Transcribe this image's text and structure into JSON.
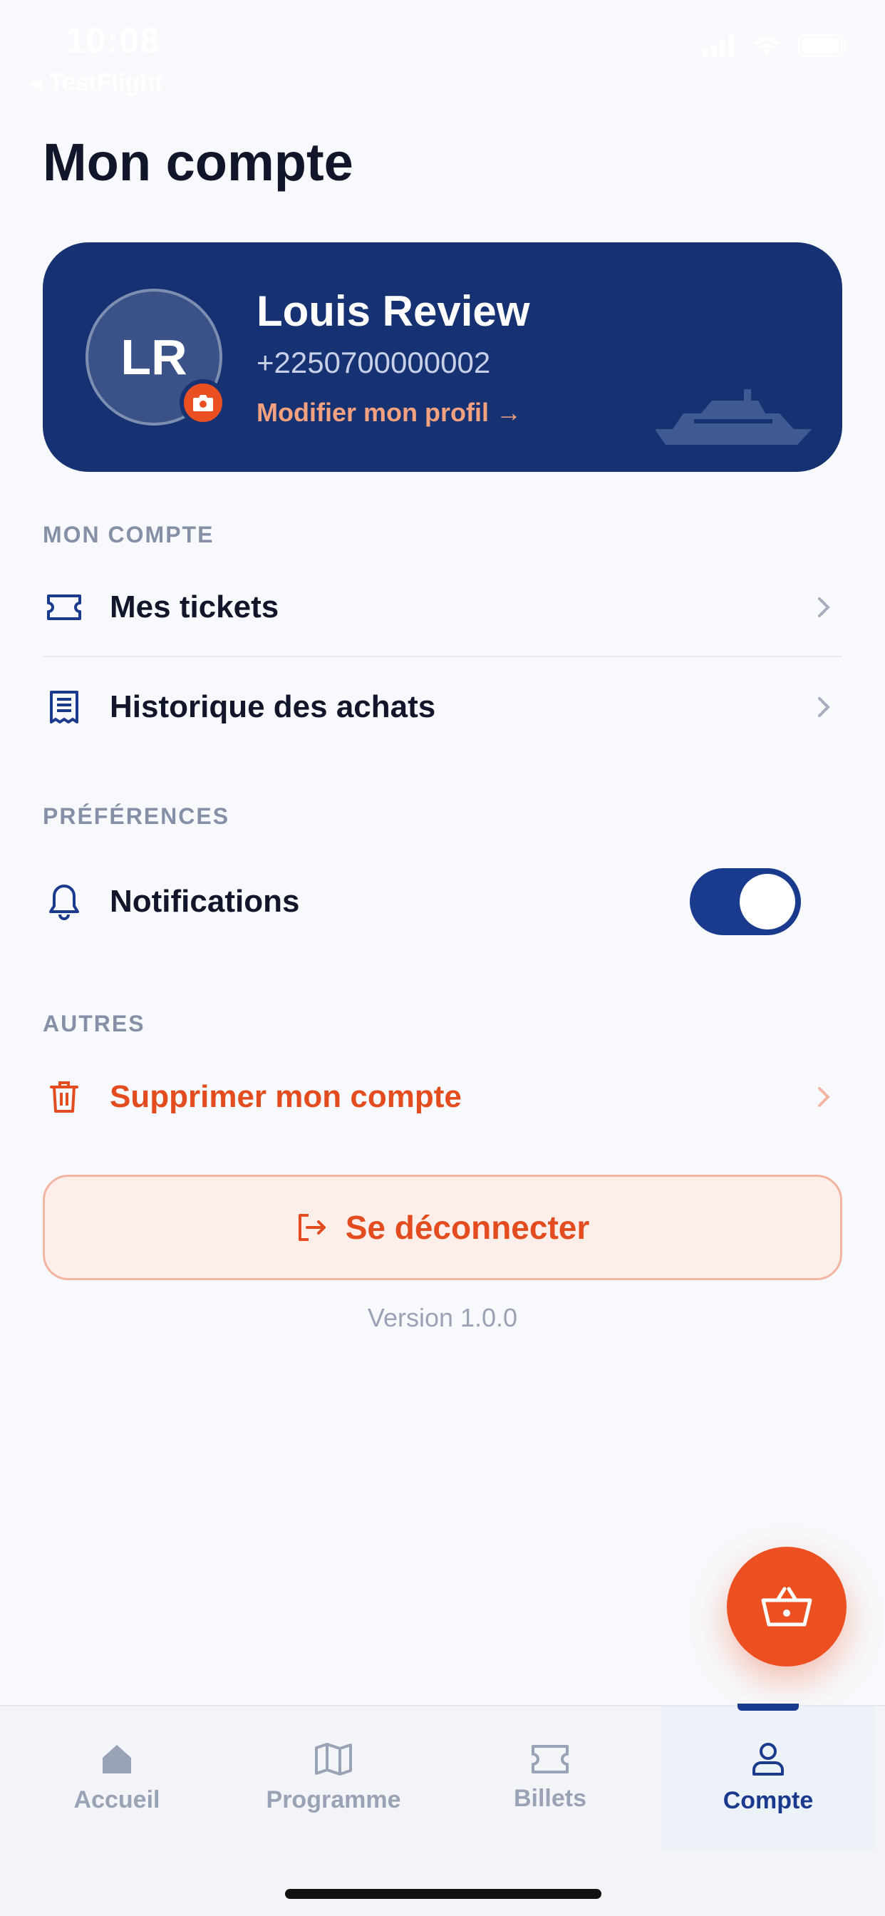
{
  "status_bar": {
    "time": "10:08",
    "back_label": "◂ TestFlight"
  },
  "page": {
    "title": "Mon compte"
  },
  "profile": {
    "initials": "LR",
    "name": "Louis Review",
    "phone": "+2250700000002",
    "edit_label": "Modifier mon profil →"
  },
  "sections": {
    "account": {
      "label": "MON COMPTE",
      "items": [
        {
          "label": "Mes tickets",
          "icon": "ticket-icon"
        },
        {
          "label": "Historique des achats",
          "icon": "receipt-icon"
        }
      ]
    },
    "preferences": {
      "label": "PRÉFÉRENCES",
      "notifications_label": "Notifications",
      "notifications_enabled": true
    },
    "others": {
      "label": "AUTRES",
      "delete_label": "Supprimer mon compte"
    }
  },
  "logout": {
    "label": "Se déconnecter"
  },
  "version": "Version 1.0.0",
  "tabs": [
    {
      "label": "Accueil",
      "icon": "home-icon",
      "active": false
    },
    {
      "label": "Programme",
      "icon": "map-icon",
      "active": false
    },
    {
      "label": "Billets",
      "icon": "ticket-icon",
      "active": false
    },
    {
      "label": "Compte",
      "icon": "user-icon",
      "active": true
    }
  ],
  "colors": {
    "primary": "#1a3b8d",
    "card": "#173273",
    "accent": "#e24c1f",
    "background": "#f8f9fc"
  }
}
